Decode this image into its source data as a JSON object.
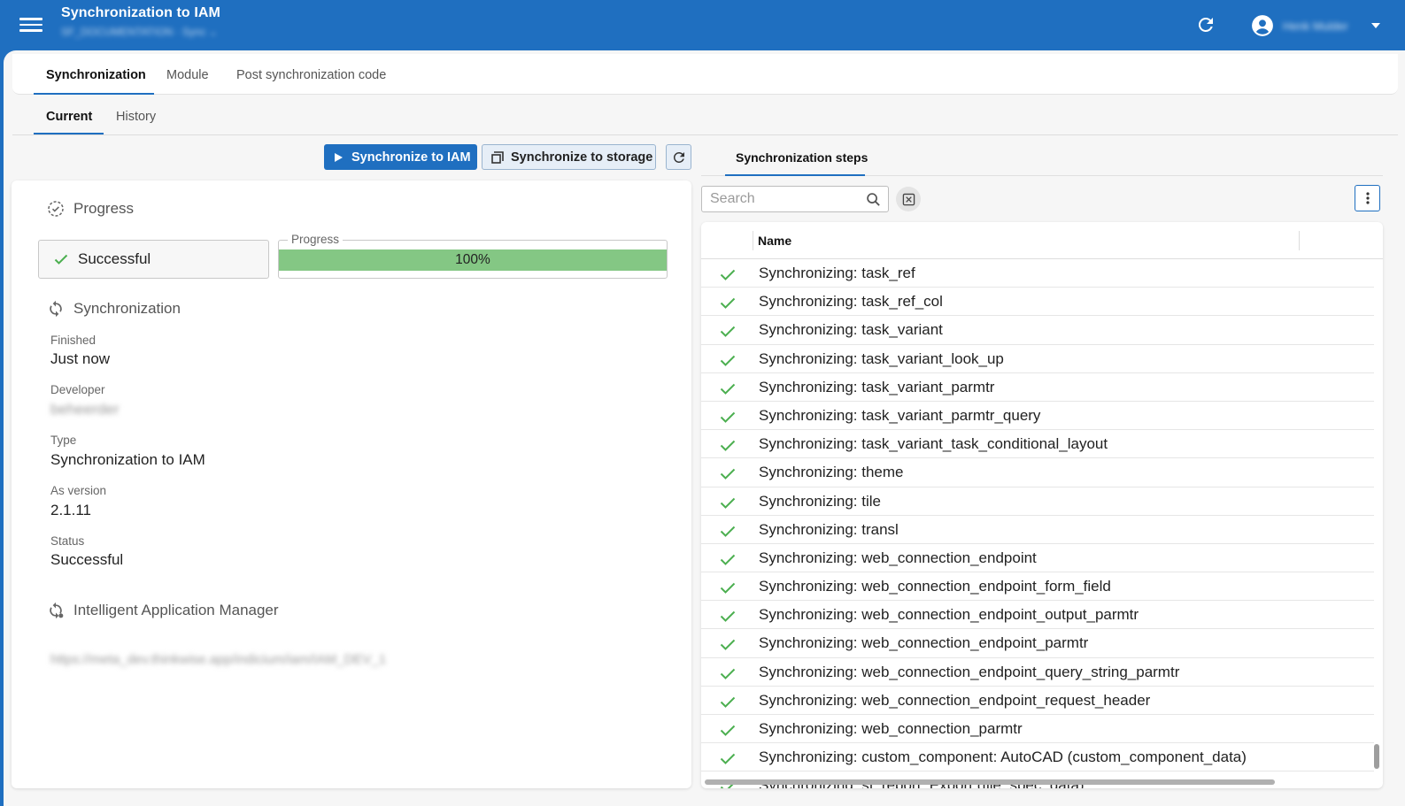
{
  "header": {
    "title": "Synchronization to IAM",
    "subtitle": "SF_DOCUMENTATION · Sync ⌄",
    "user_name": "Henk Mulder",
    "icons": {
      "menu": "hamburger-icon",
      "refresh": "refresh-icon",
      "user": "account-circle-icon",
      "caret": "caret-down-icon"
    }
  },
  "tabs_primary": [
    {
      "label": "Synchronization",
      "active": true
    },
    {
      "label": "Module",
      "active": false
    },
    {
      "label": "Post synchronization code",
      "active": false
    }
  ],
  "tabs_secondary": [
    {
      "label": "Current",
      "active": true
    },
    {
      "label": "History",
      "active": false
    }
  ],
  "toolbar": {
    "sync_iam_label": "Synchronize to IAM",
    "sync_storage_label": "Synchronize to storage"
  },
  "progress_section": {
    "heading": "Progress",
    "status": "Successful",
    "progress_legend": "Progress",
    "progress_text": "100%",
    "progress_value": 1.0
  },
  "sync_section": {
    "heading": "Synchronization",
    "fields": [
      {
        "label": "Finished",
        "value": "Just now"
      },
      {
        "label": "Developer",
        "value": "beheerder"
      },
      {
        "label": "Type",
        "value": "Synchronization to IAM"
      },
      {
        "label": "As version",
        "value": "2.1.11"
      },
      {
        "label": "Status",
        "value": "Successful"
      }
    ]
  },
  "iam_section": {
    "heading": "Intelligent Application Manager",
    "url": "https://meta_dev.thinkwise.app/indicium/iam/IAM_DEV_1"
  },
  "steps": {
    "tab_label": "Synchronization steps",
    "search_placeholder": "Search",
    "column_name": "Name",
    "rows": [
      "Synchronizing: task_ref",
      "Synchronizing: task_ref_col",
      "Synchronizing: task_variant",
      "Synchronizing: task_variant_look_up",
      "Synchronizing: task_variant_parmtr",
      "Synchronizing: task_variant_parmtr_query",
      "Synchronizing: task_variant_task_conditional_layout",
      "Synchronizing: theme",
      "Synchronizing: tile",
      "Synchronizing: transl",
      "Synchronizing: web_connection_endpoint",
      "Synchronizing: web_connection_endpoint_form_field",
      "Synchronizing: web_connection_endpoint_output_parmtr",
      "Synchronizing: web_connection_endpoint_parmtr",
      "Synchronizing: web_connection_endpoint_query_string_parmtr",
      "Synchronizing: web_connection_endpoint_request_header",
      "Synchronizing: web_connection_parmtr",
      "Synchronizing: custom_component: AutoCAD (custom_component_data)",
      "Synchronizing: sf_report: Export (file_spec_data)"
    ]
  },
  "colors": {
    "brand": "#1f6fc0",
    "success": "#4caf50",
    "progress_fill": "#84c784"
  }
}
